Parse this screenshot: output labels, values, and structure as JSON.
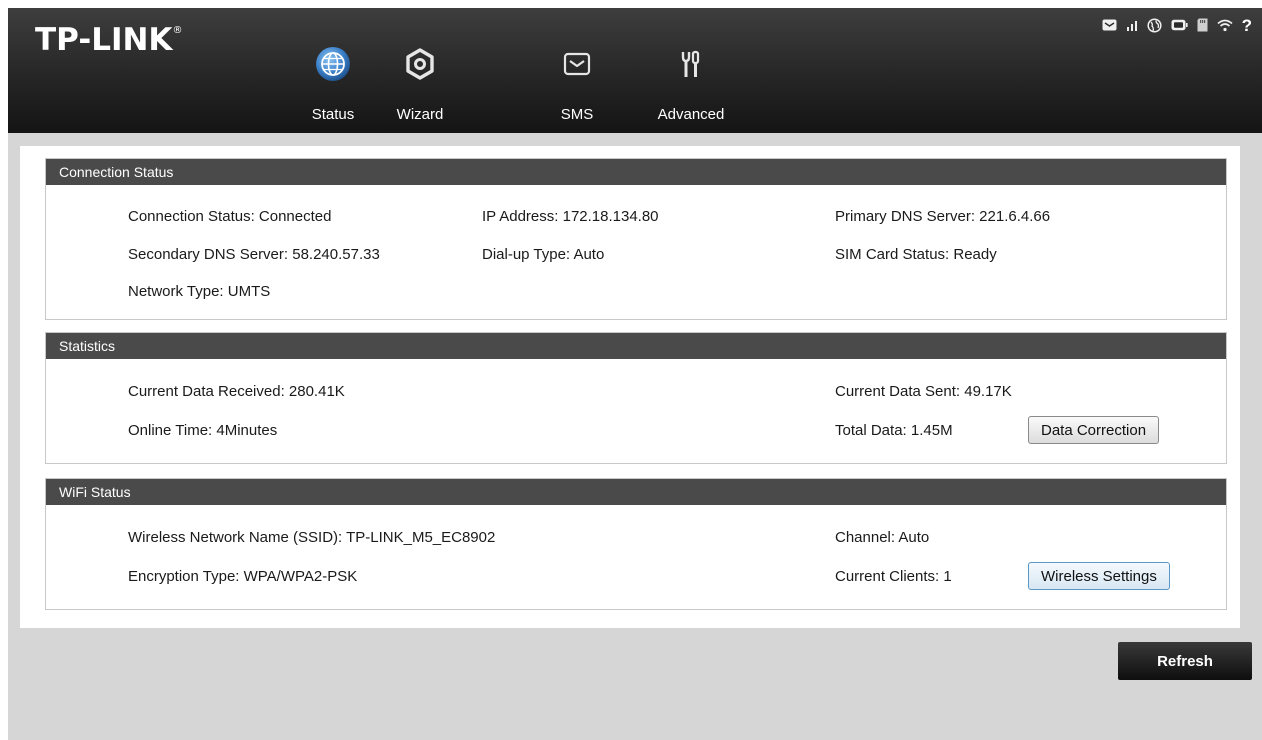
{
  "header": {
    "logo": "TP-LINK",
    "logo_mark": "®",
    "nav": [
      {
        "label": "Status",
        "icon": "globe-icon",
        "active": true
      },
      {
        "label": "Wizard",
        "icon": "settings-ring-icon"
      },
      {
        "label": "SMS",
        "icon": "envelope-icon"
      },
      {
        "label": "Advanced",
        "icon": "tools-icon"
      }
    ],
    "status_icons": [
      "message-icon",
      "signal-icon",
      "internet-icon",
      "battery-icon",
      "sd-card-icon",
      "wifi-icon",
      "help-icon"
    ],
    "help_glyph": "?"
  },
  "connection": {
    "title": "Connection Status",
    "connection_status": "Connection Status: Connected",
    "ip_address": "IP Address: 172.18.134.80",
    "primary_dns": "Primary DNS Server: 221.6.4.66",
    "secondary_dns": "Secondary DNS Server: 58.240.57.33",
    "dialup_type": "Dial-up Type: Auto",
    "sim_status": "SIM Card Status: Ready",
    "network_type": "Network Type: UMTS"
  },
  "statistics": {
    "title": "Statistics",
    "received": "Current Data Received: 280.41K",
    "sent": "Current Data Sent: 49.17K",
    "online_time": "Online Time: 4Minutes",
    "total_data": "Total Data: 1.45M",
    "data_correction_label": "Data Correction"
  },
  "wifi": {
    "title": "WiFi Status",
    "ssid": "Wireless Network Name (SSID): TP-LINK_M5_EC8902",
    "channel": "Channel: Auto",
    "encryption": "Encryption Type: WPA/WPA2-PSK",
    "clients": "Current Clients: 1",
    "wireless_settings_label": "Wireless Settings"
  },
  "refresh_label": "Refresh",
  "colors": {
    "header_bg": "#2a2a2a",
    "panel_title_bg": "#4a4a4a",
    "page_bg": "#d6d6d6",
    "accent_blue": "#3a7fc8"
  }
}
